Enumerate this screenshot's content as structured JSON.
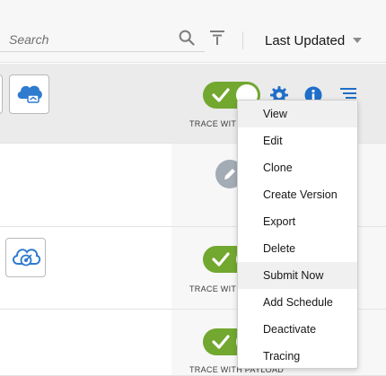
{
  "search": {
    "placeholder": "Search",
    "value": ""
  },
  "sort": {
    "label": "Last Updated"
  },
  "rows": [
    {
      "trace_label": "TRACE WITH PAYLOAD"
    },
    {
      "trace_label": ""
    },
    {
      "trace_label": "TRACE WITH PAYLOAD"
    },
    {
      "trace_label": "TRACE WITH PAYLOAD"
    }
  ],
  "menu": {
    "items": [
      {
        "label": "View"
      },
      {
        "label": "Edit"
      },
      {
        "label": "Clone"
      },
      {
        "label": "Create Version"
      },
      {
        "label": "Export"
      },
      {
        "label": "Delete"
      },
      {
        "label": "Submit Now"
      },
      {
        "label": "Add Schedule"
      },
      {
        "label": "Deactivate"
      },
      {
        "label": "Tracing"
      }
    ]
  },
  "icons": {
    "search": "search-icon",
    "filter": "filter-icon",
    "settings": "gear-icon",
    "info": "info-icon",
    "actions": "menu-lines-icon",
    "edit": "pencil-icon",
    "integration_cloud": "cloud-share-icon",
    "integration_target": "cloud-target-icon"
  },
  "colors": {
    "toggle_on": "#72a730",
    "accent_blue": "#1f6ec8",
    "edit_badge": "#a3acb5",
    "menu_highlight": "#f0f0f0"
  }
}
